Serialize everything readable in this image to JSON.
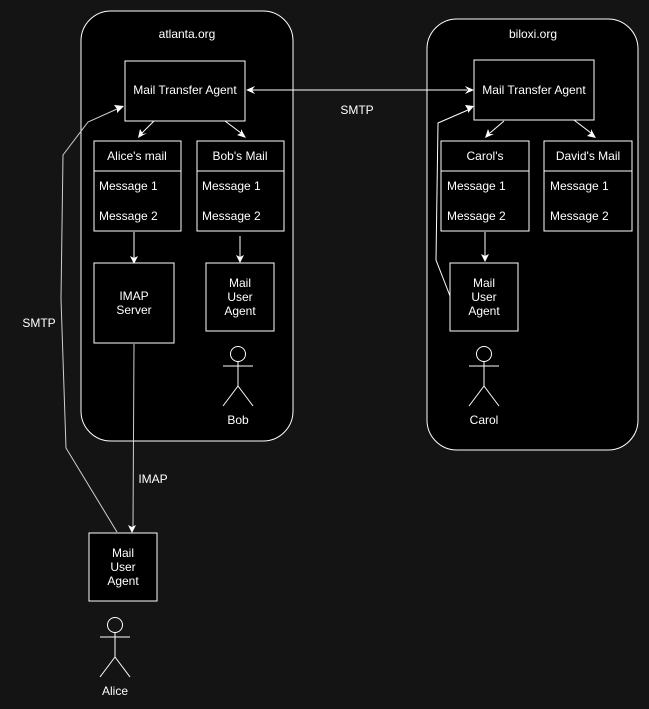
{
  "colors": {
    "canvas_background": "#141414",
    "node_fill": "#000000",
    "stroke": "#ffffff",
    "text": "#ffffff"
  },
  "domains": {
    "atlanta": {
      "label": "atlanta.org",
      "mta": "Mail Transfer Agent",
      "mailboxes": [
        {
          "title": "Alice's mail",
          "messages": [
            "Message 1",
            "Message 2"
          ]
        },
        {
          "title": "Bob's Mail",
          "messages": [
            "Message 1",
            "Message 2"
          ]
        }
      ],
      "imap_server": [
        "IMAP",
        "Server"
      ],
      "bob_mua": [
        "Mail",
        "User",
        "Agent"
      ],
      "bob_actor": "Bob"
    },
    "biloxi": {
      "label": "biloxi.org",
      "mta": "Mail Transfer Agent",
      "mailboxes": [
        {
          "title": "Carol's",
          "messages": [
            "Message 1",
            "Message 2"
          ]
        },
        {
          "title": "David's Mail",
          "messages": [
            "Message 1",
            "Message 2"
          ]
        }
      ],
      "carol_mua": [
        "Mail",
        "User",
        "Agent"
      ],
      "carol_actor": "Carol"
    }
  },
  "external": {
    "alice_mua": [
      "Mail",
      "User",
      "Agent"
    ],
    "alice_actor": "Alice"
  },
  "edges": {
    "mta_to_mta": "SMTP",
    "alice_smtp": "SMTP",
    "alice_imap": "IMAP"
  }
}
